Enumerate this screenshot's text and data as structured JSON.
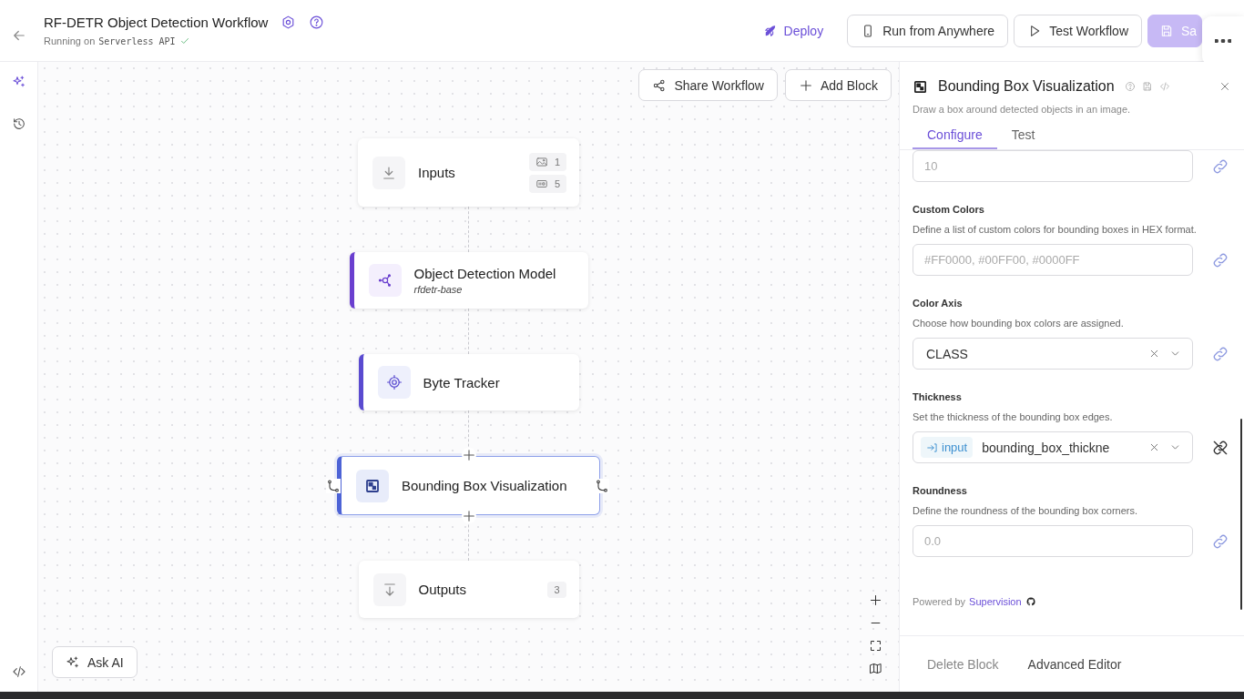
{
  "header": {
    "title": "RF-DETR Object Detection Workflow",
    "status_prefix": "Running on",
    "status_target": "Serverless API",
    "deploy": "Deploy",
    "buttons": [
      {
        "label": "Run from Anywhere",
        "kind": "phone"
      },
      {
        "label": "Test Workflow",
        "kind": "play"
      },
      {
        "label": "Sa",
        "kind": "save"
      }
    ]
  },
  "canvas": {
    "toolbar": [
      {
        "label": "Share Workflow",
        "kind": "share"
      },
      {
        "label": "Add Block",
        "kind": "add"
      }
    ],
    "nodes": [
      {
        "kind": "input",
        "title": "Inputs",
        "selected": false,
        "badges": [
          {
            "kind": "image",
            "count": "1"
          },
          {
            "kind": "param",
            "count": "5"
          }
        ]
      },
      {
        "kind": "model",
        "title": "Object Detection Model",
        "subtitle": "rfdetr-base",
        "selected": false
      },
      {
        "kind": "tracker",
        "title": "Byte Tracker",
        "selected": false
      },
      {
        "kind": "visualization",
        "title": "Bounding Box Visualization",
        "selected": true
      },
      {
        "kind": "output",
        "title": "Outputs",
        "selected": false,
        "badges": [
          {
            "kind": "plain",
            "count": "3"
          }
        ]
      }
    ],
    "ask_ai": "Ask AI"
  },
  "panel": {
    "title": "Bounding Box Visualization",
    "description": "Draw a box around detected objects in an image.",
    "tabs": [
      {
        "label": "Configure",
        "selected": true
      },
      {
        "label": "Test",
        "selected": false
      }
    ],
    "fields": [
      {
        "kind": "text",
        "placeholder": "10",
        "linked": true
      },
      {
        "kind": "text",
        "label": "Custom Colors",
        "help": "Define a list of custom colors for bounding boxes in HEX format.",
        "placeholder": "#FF0000, #00FF00, #0000FF",
        "linked": true
      },
      {
        "kind": "select",
        "label": "Color Axis",
        "help": "Choose how bounding box colors are assigned.",
        "value": "CLASS",
        "linked": true
      },
      {
        "kind": "reference",
        "label": "Thickness",
        "help": "Set the thickness of the bounding box edges.",
        "tag": "input",
        "value": "bounding_box_thickne",
        "linked": false
      },
      {
        "kind": "text",
        "label": "Roundness",
        "help": "Define the roundness of the bounding box corners.",
        "placeholder": "0.0",
        "linked": true
      }
    ],
    "powered_prefix": "Powered by",
    "powered_link": "Supervision",
    "footer": [
      {
        "label": "Delete Block",
        "kind": "danger"
      },
      {
        "label": "Advanced Editor",
        "kind": "default"
      }
    ]
  }
}
